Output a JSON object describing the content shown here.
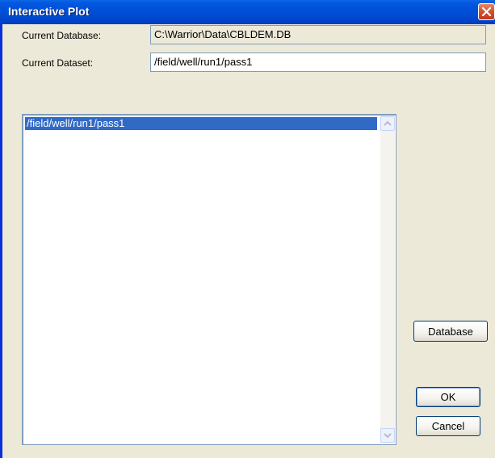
{
  "window": {
    "title": "Interactive Plot"
  },
  "fields": {
    "current_database_label": "Current Database:",
    "current_database_value": "C:\\Warrior\\Data\\CBLDEM.DB",
    "current_dataset_label": "Current Dataset:",
    "current_dataset_value": "/field/well/run1/pass1"
  },
  "list": {
    "items": [
      "/field/well/run1/pass1"
    ],
    "selected_index": 0
  },
  "buttons": {
    "database": "Database",
    "ok": "OK",
    "cancel": "Cancel"
  },
  "colors": {
    "titlebar": "#0054e3",
    "selection": "#316ac5",
    "window_bg": "#ece9d8"
  }
}
